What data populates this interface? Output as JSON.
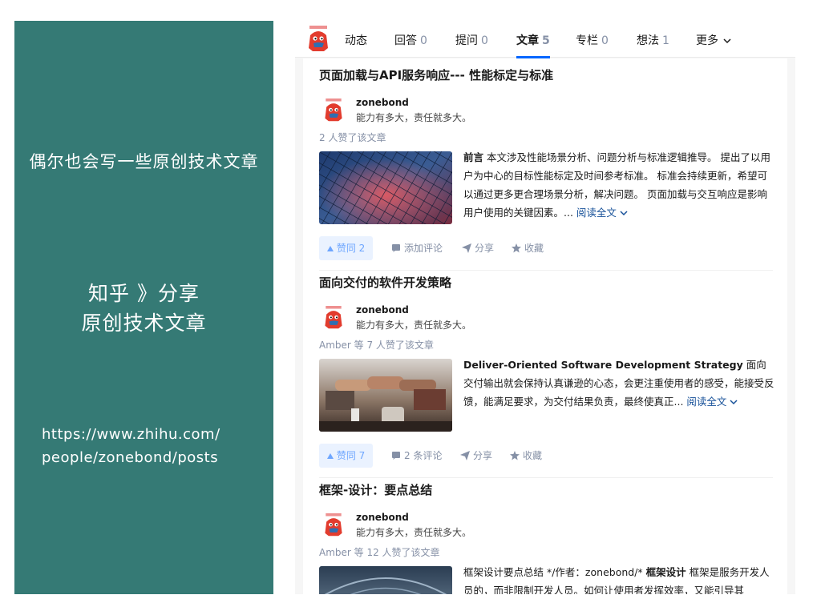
{
  "left_panel": {
    "tagline": "偶尔也会写一些原创技术文章",
    "heading_line1": "知乎 》分享",
    "heading_line2": "原创技术文章",
    "url_line1": "https://www.zhihu.com/",
    "url_line2": "people/zonebond/posts",
    "bg_color": "#357a75"
  },
  "tabs": [
    {
      "label": "动态",
      "count": ""
    },
    {
      "label": "回答",
      "count": "0"
    },
    {
      "label": "提问",
      "count": "0"
    },
    {
      "label": "文章",
      "count": "5"
    },
    {
      "label": "专栏",
      "count": "0"
    },
    {
      "label": "想法",
      "count": "1"
    },
    {
      "label": "更多",
      "count": ""
    }
  ],
  "active_tab": "文章",
  "articles": [
    {
      "title": "页面加载与API服务响应--- 性能标定与标准",
      "author": "zonebond",
      "bio": "能力有多大，责任就多大。",
      "likes": "2 人赞了该文章",
      "excerpt_bold": "前言",
      "excerpt": " 本文涉及性能场景分析、问题分析与标准逻辑推导。 提出了以用户为中心的目标性能标定及时间参考标准。 标准会持续更新，希望可以通过更多更合理场景分析，解决问题。 页面加载与交互响应是影响用户使用的关键因素。...",
      "read_more": "阅读全文",
      "vote": "赞同 2",
      "comment": "添加评论",
      "share": "分享",
      "collect": "收藏"
    },
    {
      "title": "面向交付的软件开发策略",
      "author": "zonebond",
      "bio": "能力有多大，责任就多大。",
      "likes": "Amber 等 7 人赞了该文章",
      "excerpt_bold": "Deliver-Oriented Software Development Strategy",
      "excerpt": " 面向交付输出就会保持认真谦逊的心态，会更注重使用者的感受，能接受反馈，能满足要求，为交付结果负责，最终使真正...",
      "read_more": "阅读全文",
      "vote": "赞同 7",
      "comment": "2 条评论",
      "share": "分享",
      "collect": "收藏"
    },
    {
      "title": "框架-设计：要点总结",
      "author": "zonebond",
      "bio": "能力有多大，责任就多大。",
      "likes": "Amber 等 12 人赞了该文章",
      "excerpt_pre": "框架设计要点总结 */作者：zonebond/* ",
      "excerpt_bold": "框架设计",
      "excerpt": " 框架是服务开发人员的，而非限制开发人员。如何让使用者发挥效率，又能引导其"
    }
  ]
}
